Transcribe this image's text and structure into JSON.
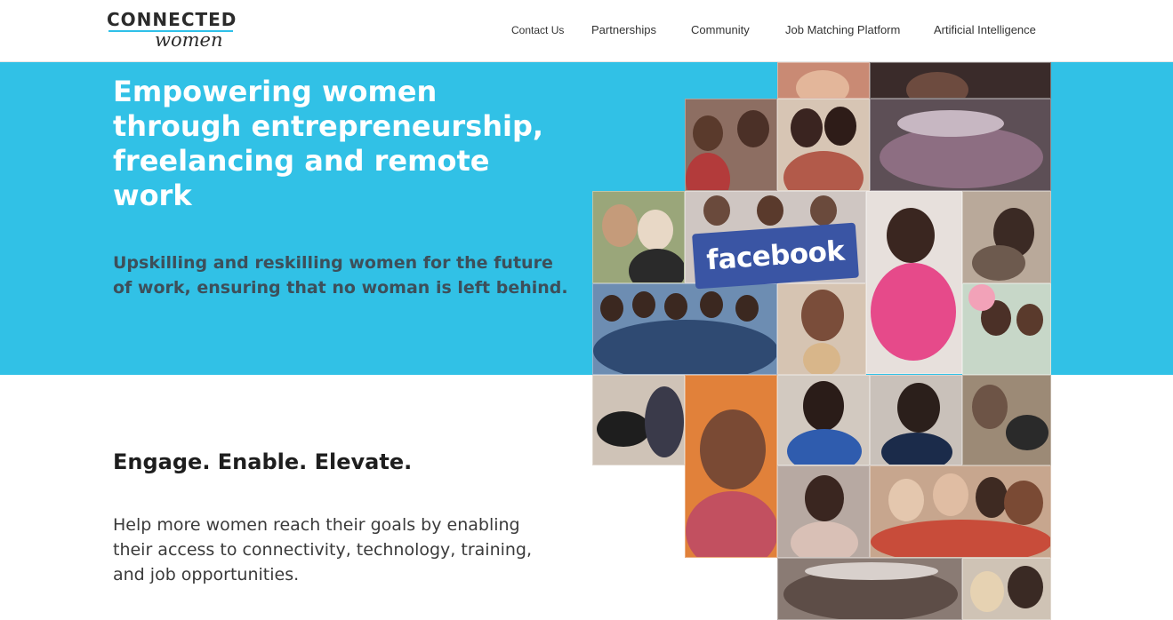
{
  "header": {
    "logo": {
      "top": "CONNECTED",
      "bottom": "women"
    },
    "nav": [
      {
        "label": "Contact Us"
      },
      {
        "label": "Partnerships"
      },
      {
        "label": "Community"
      },
      {
        "label": "Job Matching Platform"
      },
      {
        "label": "Artificial Intelligence"
      }
    ]
  },
  "hero": {
    "title": "Empowering women through entrepreneurship, freelancing and remote work",
    "subtitle": "Upskilling and reskilling women for the future of work, ensuring that no woman is left behind."
  },
  "section": {
    "tagline": "Engage. Enable. Elevate.",
    "description": "Help more women reach their goals by enabling their access to connectivity, technology, training, and job opportunities."
  },
  "collage": {
    "banner_text": "facebook"
  },
  "colors": {
    "hero_bg": "#31c1e6",
    "subtitle": "#3d4f5a",
    "logo_accent": "#2fc0e8"
  }
}
